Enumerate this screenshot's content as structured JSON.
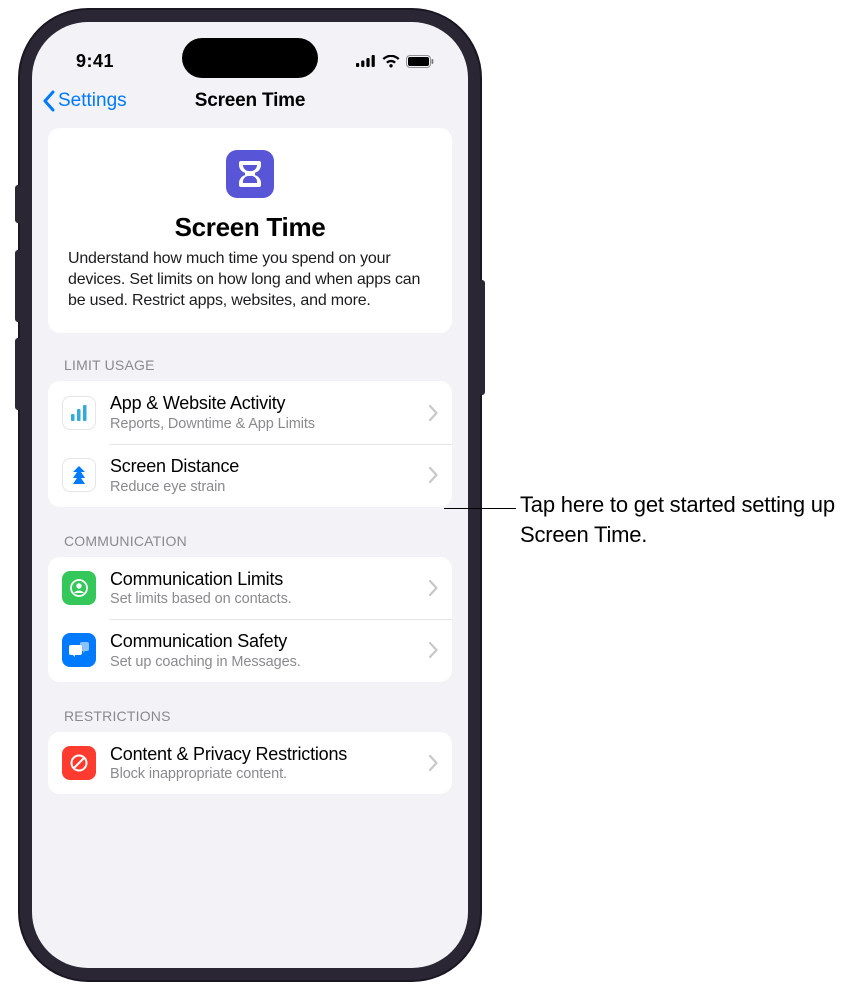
{
  "status": {
    "time": "9:41"
  },
  "nav": {
    "back": "Settings",
    "title": "Screen Time"
  },
  "hero": {
    "title": "Screen Time",
    "description": "Understand how much time you spend on your devices. Set limits on how long and when apps can be used. Restrict apps, websites, and more."
  },
  "sections": {
    "limit_usage": {
      "header": "LIMIT USAGE",
      "rows": [
        {
          "title": "App & Website Activity",
          "subtitle": "Reports, Downtime & App Limits"
        },
        {
          "title": "Screen Distance",
          "subtitle": "Reduce eye strain"
        }
      ]
    },
    "communication": {
      "header": "COMMUNICATION",
      "rows": [
        {
          "title": "Communication Limits",
          "subtitle": "Set limits based on contacts."
        },
        {
          "title": "Communication Safety",
          "subtitle": "Set up coaching in Messages."
        }
      ]
    },
    "restrictions": {
      "header": "RESTRICTIONS",
      "rows": [
        {
          "title": "Content & Privacy Restrictions",
          "subtitle": "Block inappropriate content."
        }
      ]
    }
  },
  "callout": {
    "text": "Tap here to get started setting up Screen Time."
  }
}
